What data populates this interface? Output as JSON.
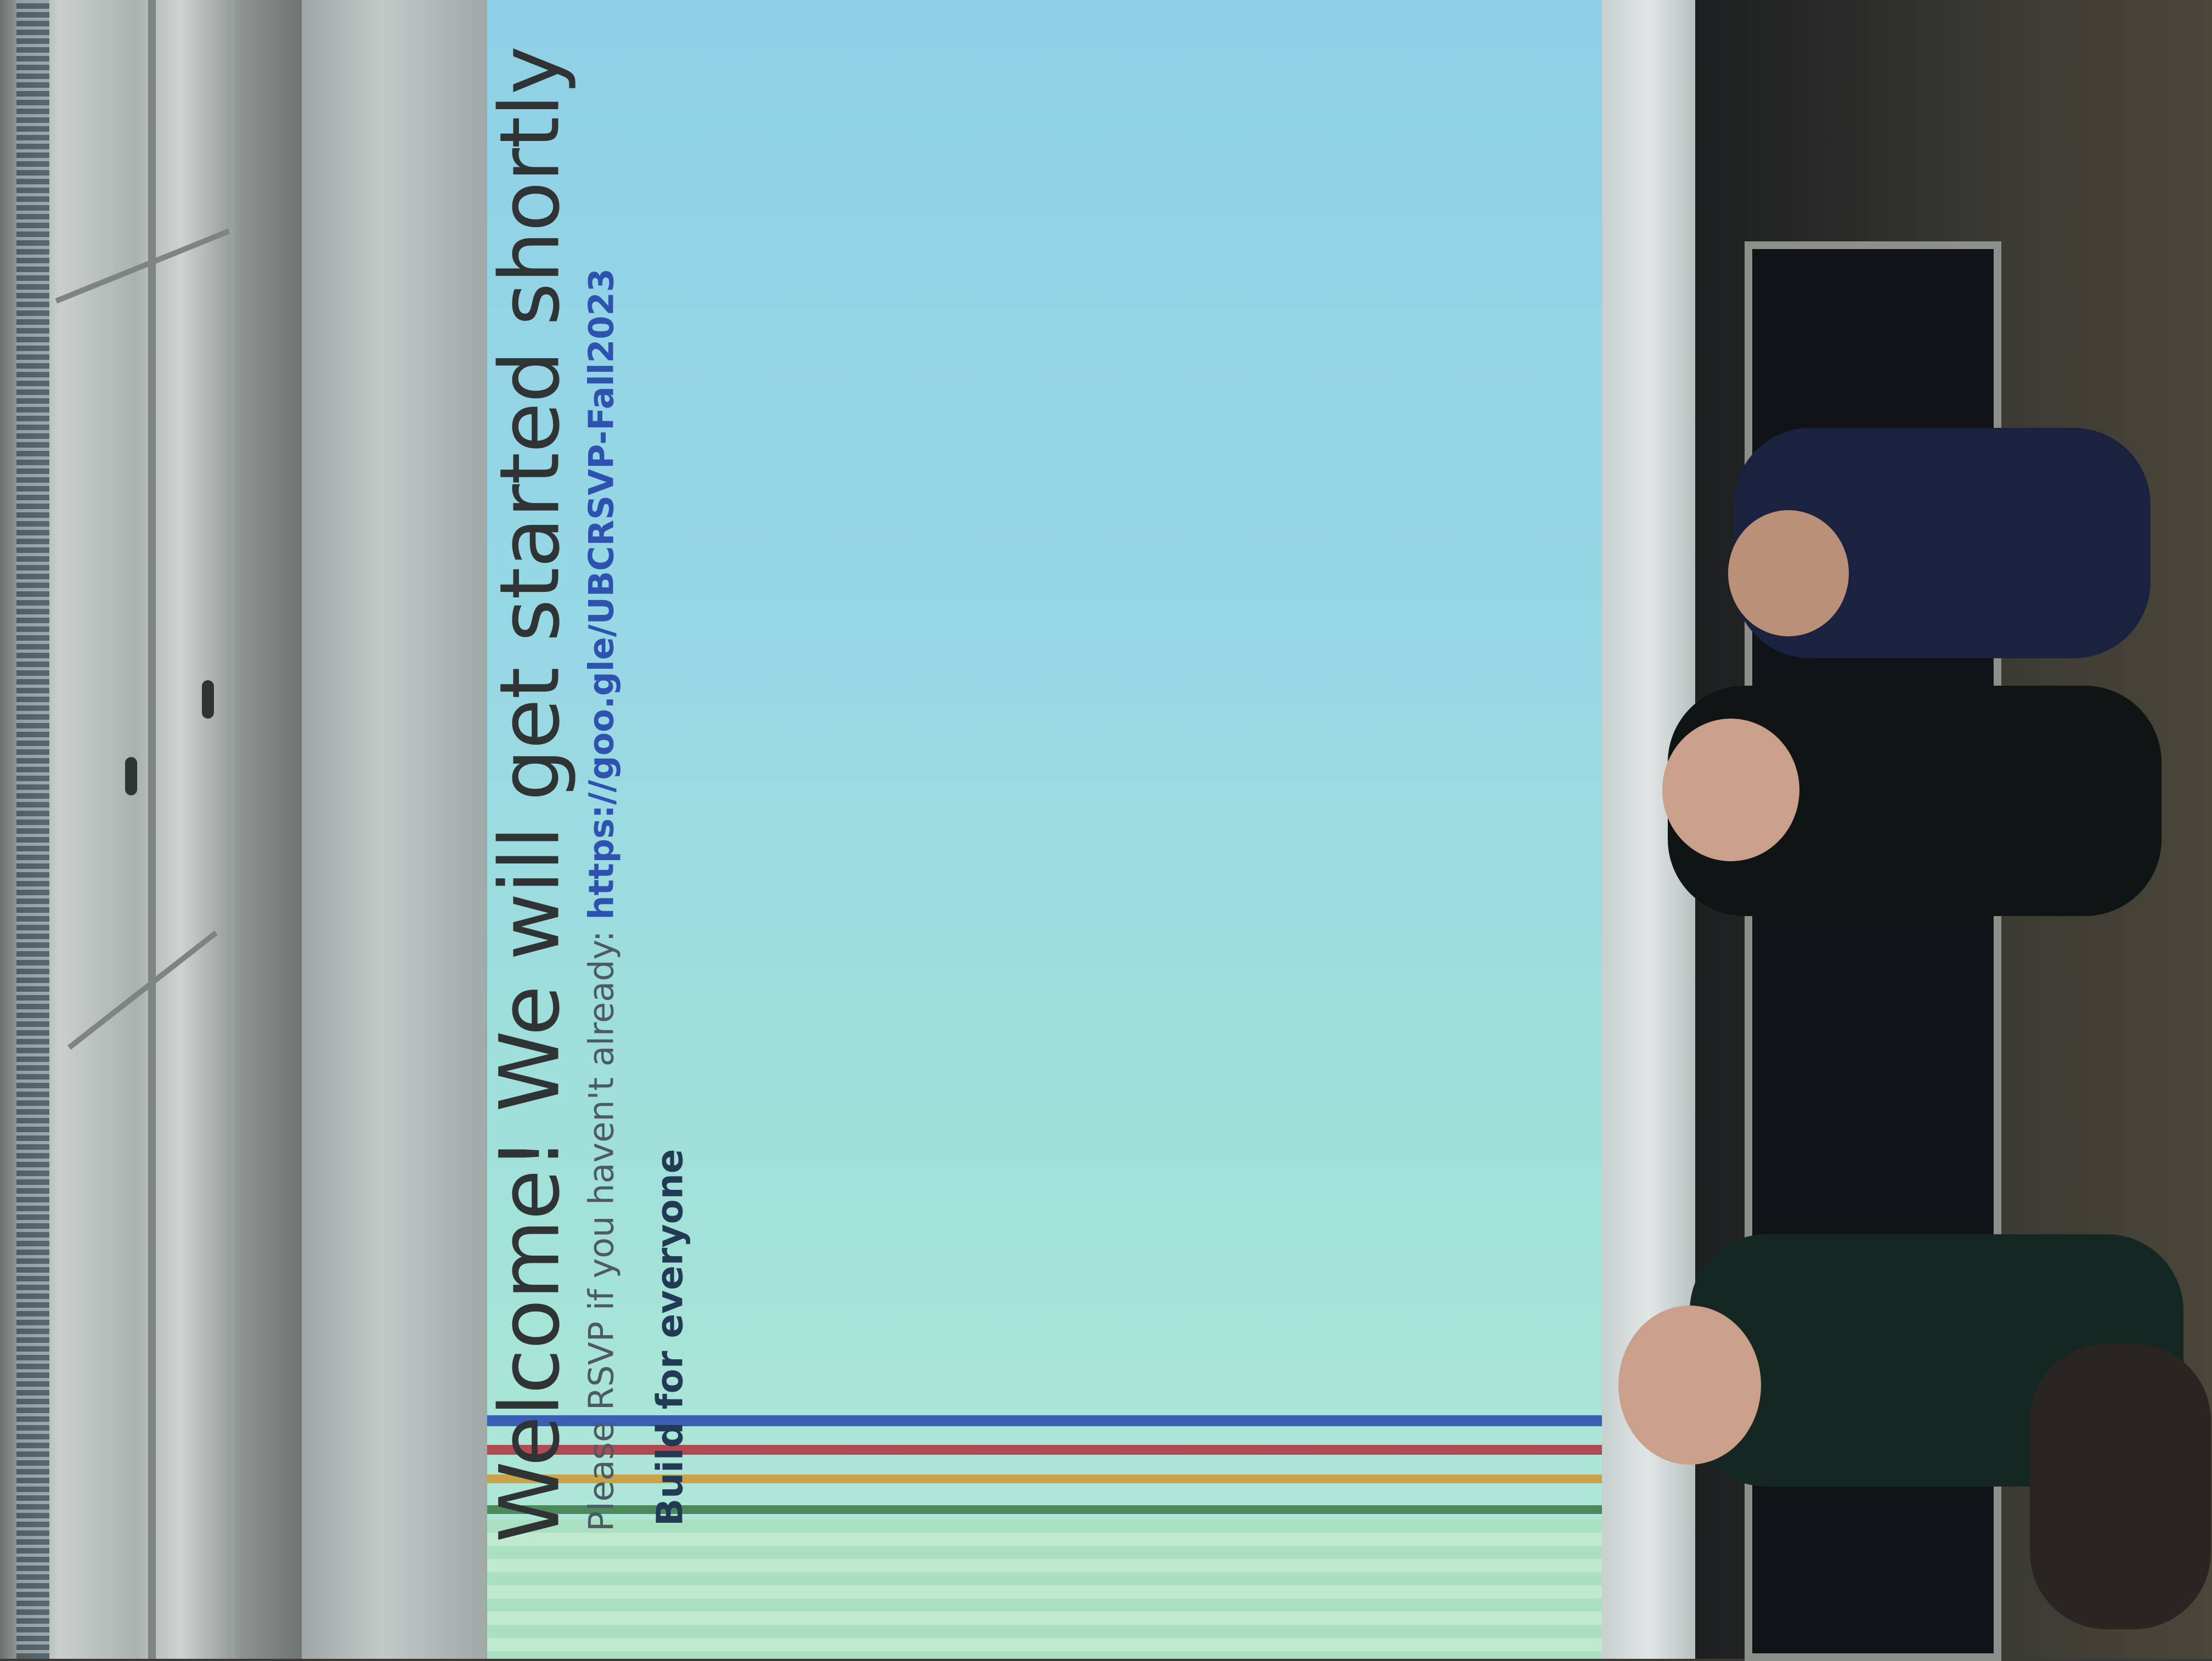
{
  "scene": {
    "description_kind": "photo of projected presentation slide in a classroom"
  },
  "slide": {
    "headline": "Welcome! We will get started shortly",
    "rsvp_prefix": "Please RSVP if you haven't already: ",
    "rsvp_link": "https://goo.gle/UBCRSVP-Fall2023",
    "tagline": "Build for everyone",
    "stripe_colors": [
      "#3a5fb5",
      "#b04a52",
      "#c9a24a",
      "#4a8a5c"
    ],
    "background_color": "#97d8e4"
  }
}
